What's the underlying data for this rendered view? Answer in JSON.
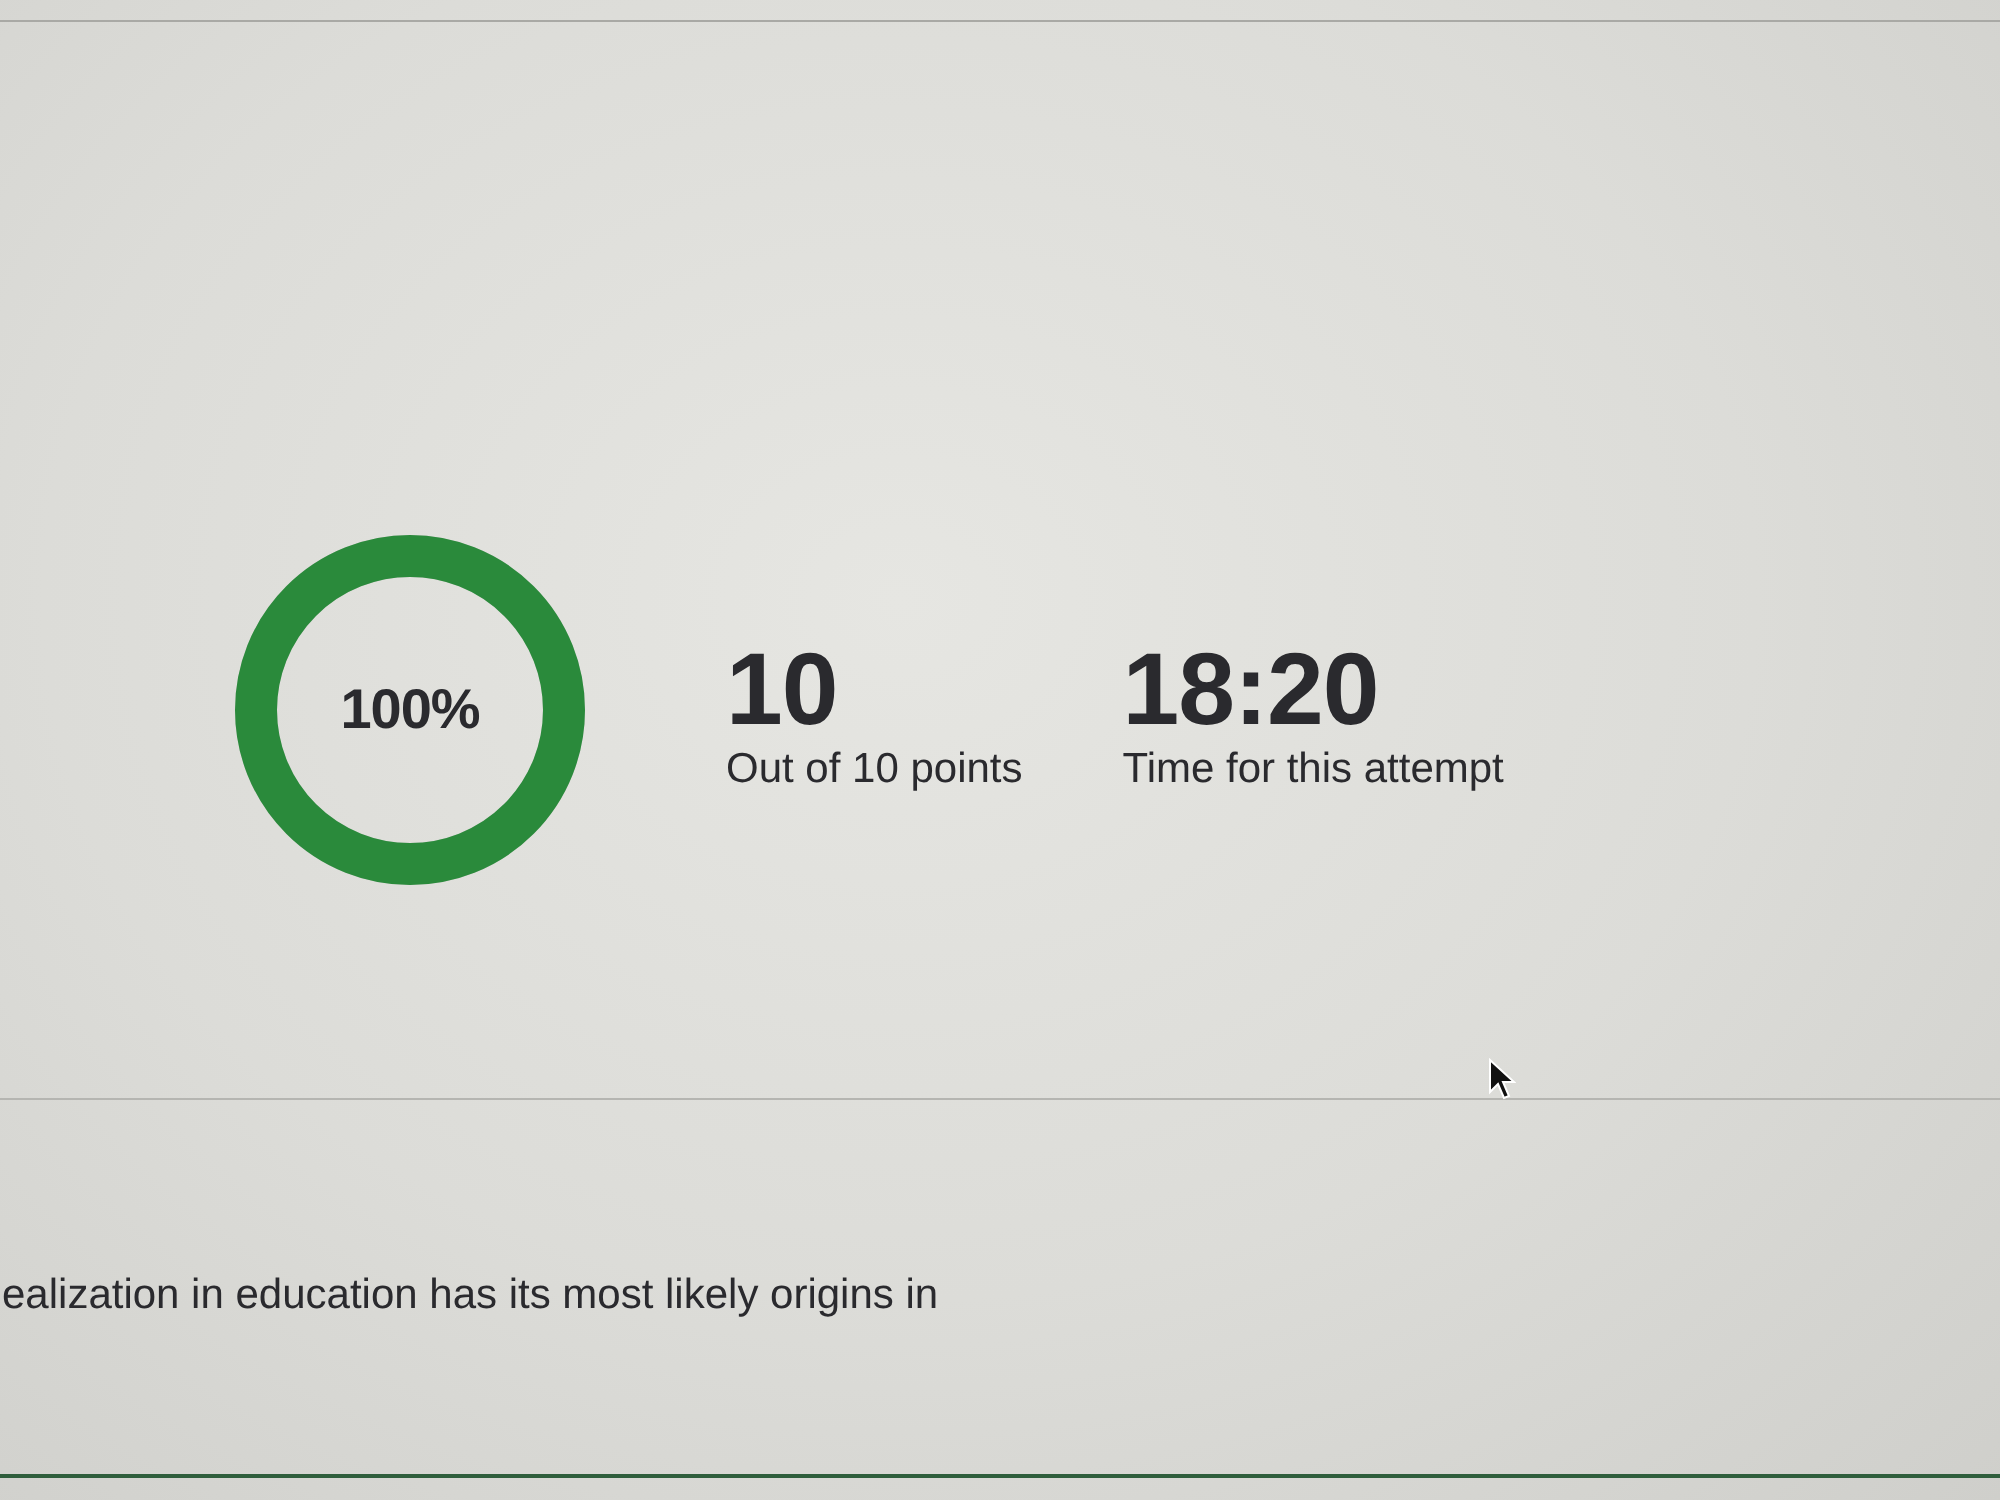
{
  "score": {
    "percent": "100%",
    "level": 1,
    "points": "10",
    "points_label": "Out of 10 points",
    "time": "18:20",
    "time_label": "Time for this attempt"
  },
  "question": {
    "text": "ealization in education has its most likely origins in"
  }
}
